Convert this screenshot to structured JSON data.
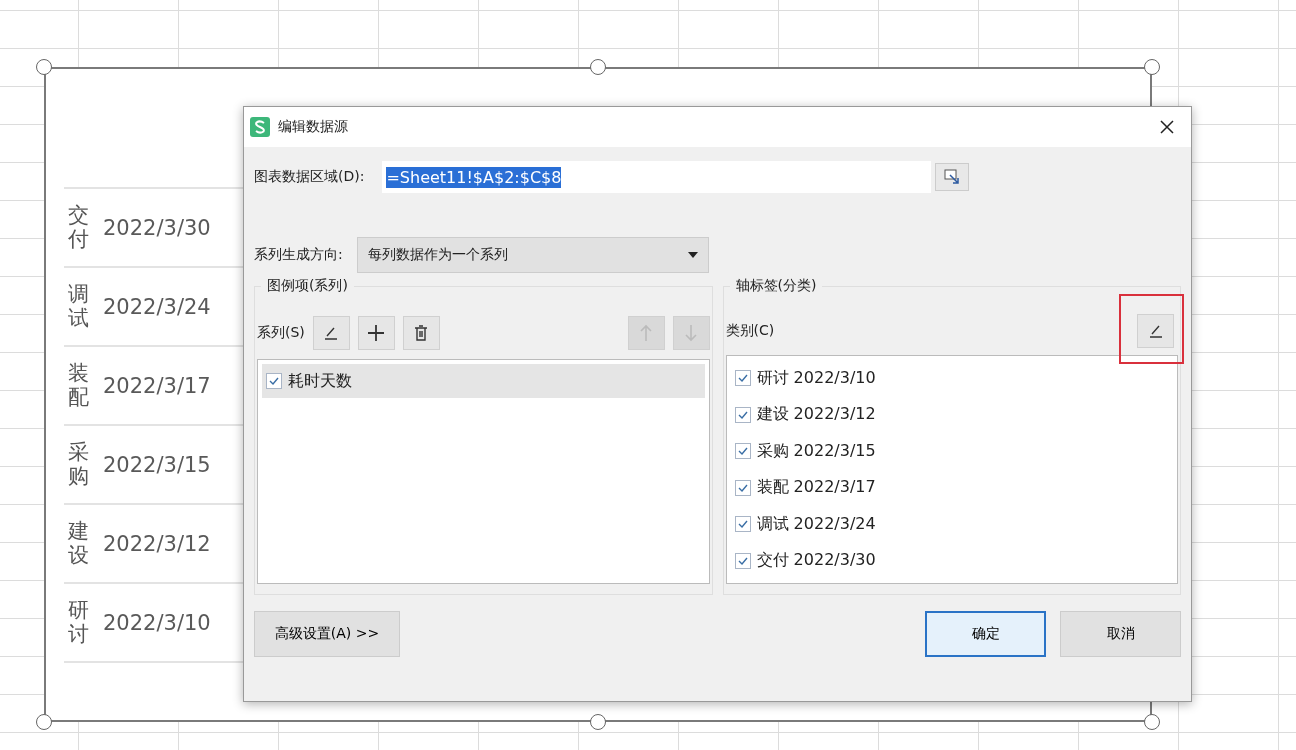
{
  "chart": {
    "selected": true,
    "rows": [
      {
        "label": "交付",
        "date": "2022/3/30"
      },
      {
        "label": "调试",
        "date": "2022/3/24"
      },
      {
        "label": "装配",
        "date": "2022/3/17"
      },
      {
        "label": "采购",
        "date": "2022/3/15"
      },
      {
        "label": "建设",
        "date": "2022/3/12"
      },
      {
        "label": "研讨",
        "date": "2022/3/10"
      }
    ]
  },
  "dialog": {
    "title": "编辑数据源",
    "data_range": {
      "label": "图表数据区域(D):",
      "value": "=Sheet11!$A$2:$C$8",
      "highlighted": true
    },
    "direction": {
      "label": "系列生成方向:",
      "value": "每列数据作为一个系列"
    },
    "series_group": {
      "title": "图例项(系列)",
      "label": "系列(S)",
      "buttons": [
        {
          "kind": "edit",
          "disabled": false
        },
        {
          "kind": "add",
          "disabled": false
        },
        {
          "kind": "delete",
          "disabled": false
        },
        {
          "kind": "up",
          "disabled": true
        },
        {
          "kind": "down",
          "disabled": true
        }
      ],
      "items": [
        {
          "label": "耗时天数",
          "checked": true,
          "selected": true
        }
      ]
    },
    "category_group": {
      "title": "轴标签(分类)",
      "label": "类别(C)",
      "edit_highlighted": true,
      "items": [
        {
          "label": "研讨 2022/3/10",
          "checked": true
        },
        {
          "label": "建设 2022/3/12",
          "checked": true
        },
        {
          "label": "采购 2022/3/15",
          "checked": true
        },
        {
          "label": "装配 2022/3/17",
          "checked": true
        },
        {
          "label": "调试 2022/3/24",
          "checked": true
        },
        {
          "label": "交付 2022/3/30",
          "checked": true
        }
      ]
    },
    "advanced_button": "高级设置(A) >>",
    "ok_button": {
      "label": "确定",
      "focused": true
    },
    "cancel_button": "取消"
  }
}
